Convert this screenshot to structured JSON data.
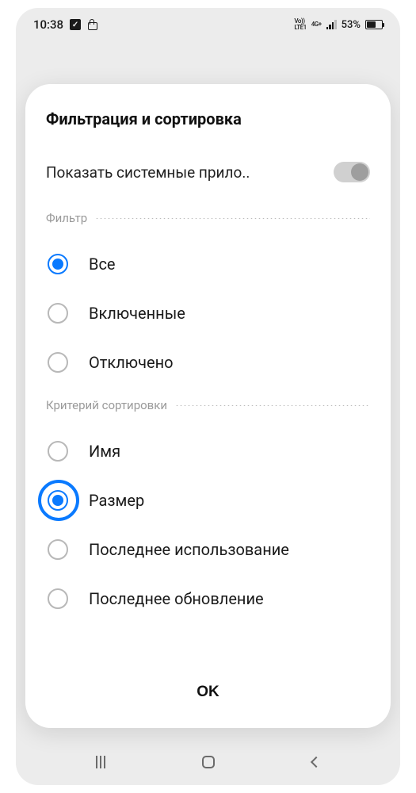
{
  "status": {
    "time": "10:38",
    "net1": "Vo))\nLTE1",
    "net2": "4G+",
    "battery_pct": "53%"
  },
  "dialog": {
    "title": "Фильтрация и сортировка",
    "toggle_label": "Показать системные прило..",
    "toggle_on": false,
    "filter_section": "Фильтр",
    "filter_options": [
      {
        "label": "Все",
        "selected": true
      },
      {
        "label": "Включенные",
        "selected": false
      },
      {
        "label": "Отключено",
        "selected": false
      }
    ],
    "sort_section": "Критерий сортировки",
    "sort_options": [
      {
        "label": "Имя",
        "selected": false
      },
      {
        "label": "Размер",
        "selected": true,
        "highlighted": true
      },
      {
        "label": "Последнее использование",
        "selected": false
      },
      {
        "label": "Последнее обновление",
        "selected": false
      }
    ],
    "ok_label": "OK"
  }
}
